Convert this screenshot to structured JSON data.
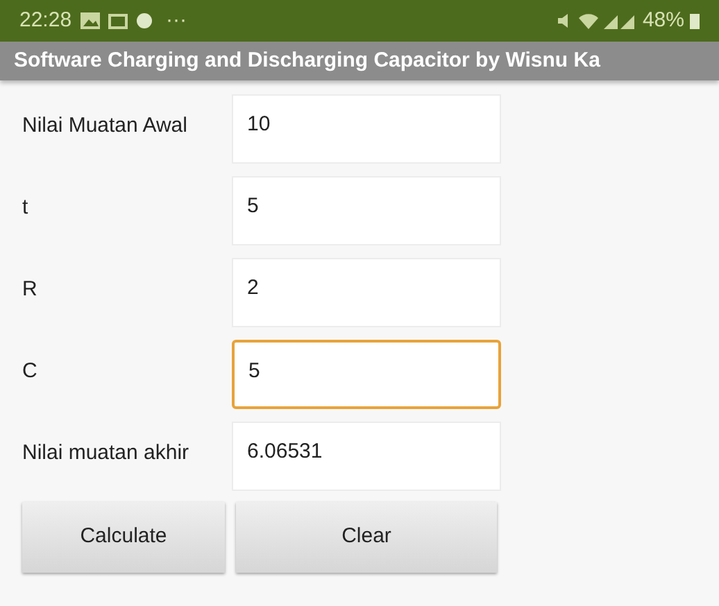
{
  "status_bar": {
    "time": "22:28",
    "dots": "···",
    "battery": "48%"
  },
  "title": "Software Charging and Discharging Capacitor by Wisnu Ka",
  "fields": [
    {
      "label": "Nilai Muatan Awal",
      "value": "10",
      "focused": false
    },
    {
      "label": "t",
      "value": "5",
      "focused": false
    },
    {
      "label": "R",
      "value": "2",
      "focused": false
    },
    {
      "label": "C",
      "value": "5",
      "focused": true
    },
    {
      "label": "Nilai muatan akhir",
      "value": "6.06531",
      "focused": false
    }
  ],
  "buttons": [
    "Calculate",
    "Clear"
  ]
}
